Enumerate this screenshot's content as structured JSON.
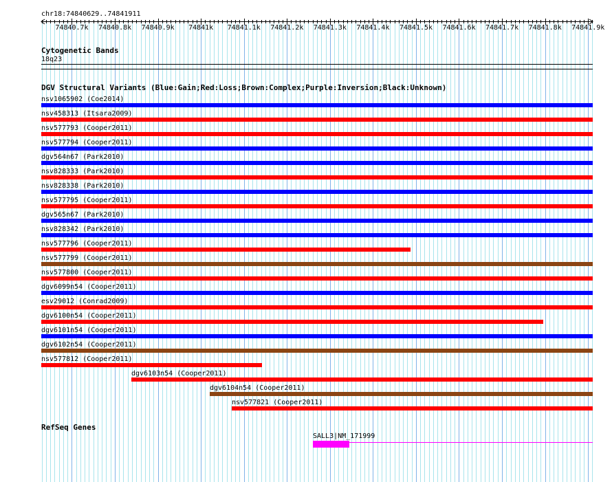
{
  "location": "chr18:74840629..74841911",
  "view": {
    "start": 74840629,
    "end": 74841911
  },
  "ruler": {
    "ticks": [
      {
        "pos": 74840700,
        "label": "74840.7k"
      },
      {
        "pos": 74840800,
        "label": "74840.8k"
      },
      {
        "pos": 74840900,
        "label": "74840.9k"
      },
      {
        "pos": 74841000,
        "label": "74841k"
      },
      {
        "pos": 74841100,
        "label": "74841.1k"
      },
      {
        "pos": 74841200,
        "label": "74841.2k"
      },
      {
        "pos": 74841300,
        "label": "74841.3k"
      },
      {
        "pos": 74841400,
        "label": "74841.4k"
      },
      {
        "pos": 74841500,
        "label": "74841.5k"
      },
      {
        "pos": 74841600,
        "label": "74841.6k"
      },
      {
        "pos": 74841700,
        "label": "74841.7k"
      },
      {
        "pos": 74841800,
        "label": "74841.8k"
      },
      {
        "pos": 74841900,
        "label": "74841.9k"
      }
    ]
  },
  "cytobands": {
    "title": "Cytogenetic Bands",
    "band": "18q23"
  },
  "dgv": {
    "title": "DGV Structural Variants (Blue:Gain;Red:Loss;Brown:Complex;Purple:Inversion;Black:Unknown)",
    "colors": {
      "gain": "#0000ff",
      "loss": "#ff0000",
      "complex": "#8b4513"
    },
    "variants": [
      {
        "label": "nsv1065902 (Coe2014)",
        "type": "gain",
        "start": 74840629,
        "end": 74841911
      },
      {
        "label": "nsv458313 (Itsara2009)",
        "type": "loss",
        "start": 74840629,
        "end": 74841911
      },
      {
        "label": "nsv577793 (Cooper2011)",
        "type": "loss",
        "start": 74840629,
        "end": 74841911
      },
      {
        "label": "nsv577794 (Cooper2011)",
        "type": "gain",
        "start": 74840629,
        "end": 74841911
      },
      {
        "label": "dgv564n67 (Park2010)",
        "type": "gain",
        "start": 74840629,
        "end": 74841911
      },
      {
        "label": "nsv828333 (Park2010)",
        "type": "loss",
        "start": 74840629,
        "end": 74841911
      },
      {
        "label": "nsv828338 (Park2010)",
        "type": "gain",
        "start": 74840629,
        "end": 74841911
      },
      {
        "label": "nsv577795 (Cooper2011)",
        "type": "loss",
        "start": 74840629,
        "end": 74841911
      },
      {
        "label": "dgv565n67 (Park2010)",
        "type": "gain",
        "start": 74840629,
        "end": 74841911
      },
      {
        "label": "nsv828342 (Park2010)",
        "type": "gain",
        "start": 74840629,
        "end": 74841911
      },
      {
        "label": "nsv577796 (Cooper2011)",
        "type": "loss",
        "start": 74840629,
        "end": 74841487
      },
      {
        "label": "nsv577799 (Cooper2011)",
        "type": "complex",
        "start": 74840629,
        "end": 74841911
      },
      {
        "label": "nsv577800 (Cooper2011)",
        "type": "loss",
        "start": 74840629,
        "end": 74841911
      },
      {
        "label": "dgv6099n54 (Cooper2011)",
        "type": "gain",
        "start": 74840629,
        "end": 74841911
      },
      {
        "label": "esv29012 (Conrad2009)",
        "type": "loss",
        "start": 74840629,
        "end": 74841911
      },
      {
        "label": "dgv6100n54 (Cooper2011)",
        "type": "loss",
        "start": 74840629,
        "end": 74841796
      },
      {
        "label": "dgv6101n54 (Cooper2011)",
        "type": "gain",
        "start": 74840629,
        "end": 74841911
      },
      {
        "label": "dgv6102n54 (Cooper2011)",
        "type": "complex",
        "start": 74840629,
        "end": 74841911
      },
      {
        "label": "nsv577812 (Cooper2011)",
        "type": "loss",
        "start": 74840629,
        "end": 74841142
      },
      {
        "label": "dgv6103n54 (Cooper2011)",
        "type": "loss",
        "start": 74840838,
        "end": 74841911
      },
      {
        "label": "dgv6104n54 (Cooper2011)",
        "type": "complex",
        "start": 74841021,
        "end": 74841911
      },
      {
        "label": "nsv577821 (Cooper2011)",
        "type": "loss",
        "start": 74841072,
        "end": 74841911
      }
    ]
  },
  "refseq": {
    "title": "RefSeq Genes",
    "gene": {
      "label": "SALL3|NM_171999",
      "color": "#ff00ff",
      "thick_start": 74841260,
      "thick_end": 74841344,
      "end": 74841911
    }
  }
}
